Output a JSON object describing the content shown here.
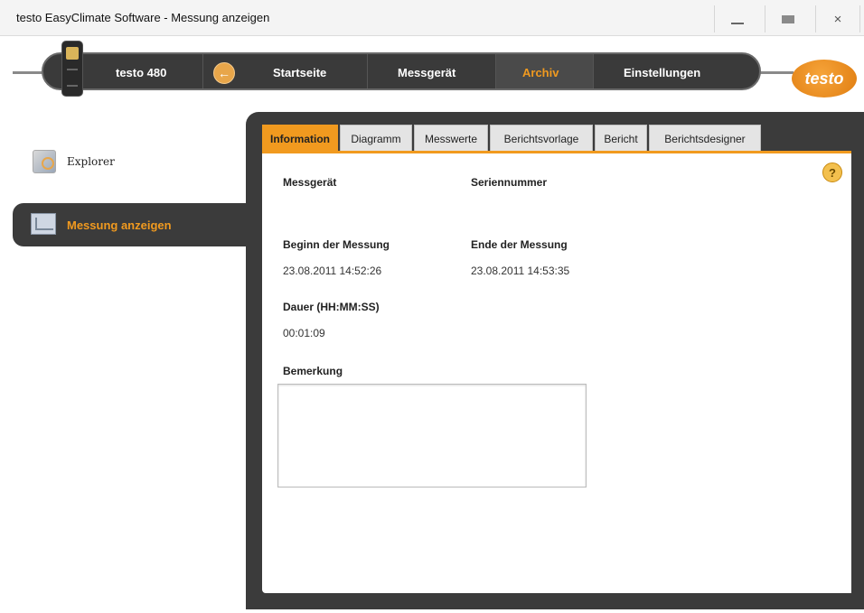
{
  "window": {
    "title": "testo EasyClimate Software - Messung anzeigen",
    "minimize": "_",
    "close": "×"
  },
  "nav": {
    "device_name": "testo 480",
    "items": [
      "Startseite",
      "Messgerät",
      "Archiv",
      "Einstellungen"
    ],
    "active": "Archiv",
    "logo": "testo",
    "back_glyph": "←"
  },
  "sidebar": {
    "items": [
      {
        "label": "Explorer",
        "icon": "explorer-icon"
      },
      {
        "label": "Messung anzeigen",
        "icon": "measurement-icon",
        "active": true
      }
    ]
  },
  "tabs": [
    "Information",
    "Diagramm",
    "Messwerte",
    "Berichtsvorlage",
    "Bericht",
    "Berichtsdesigner"
  ],
  "active_tab": "Information",
  "info": {
    "messgeraet_label": "Messgerät",
    "seriennummer_label": "Seriennummer",
    "beginn_label": "Beginn der Messung",
    "beginn_value": "23.08.2011 14:52:26",
    "ende_label": "Ende der Messung",
    "ende_value": "23.08.2011 14:53:35",
    "dauer_label": "Dauer (HH:MM:SS)",
    "dauer_value": "00:01:09",
    "bemerkung_label": "Bemerkung",
    "bemerkung_value": ""
  },
  "help_glyph": "?",
  "colors": {
    "accent": "#f19a1f",
    "dark": "#3b3b3b"
  }
}
